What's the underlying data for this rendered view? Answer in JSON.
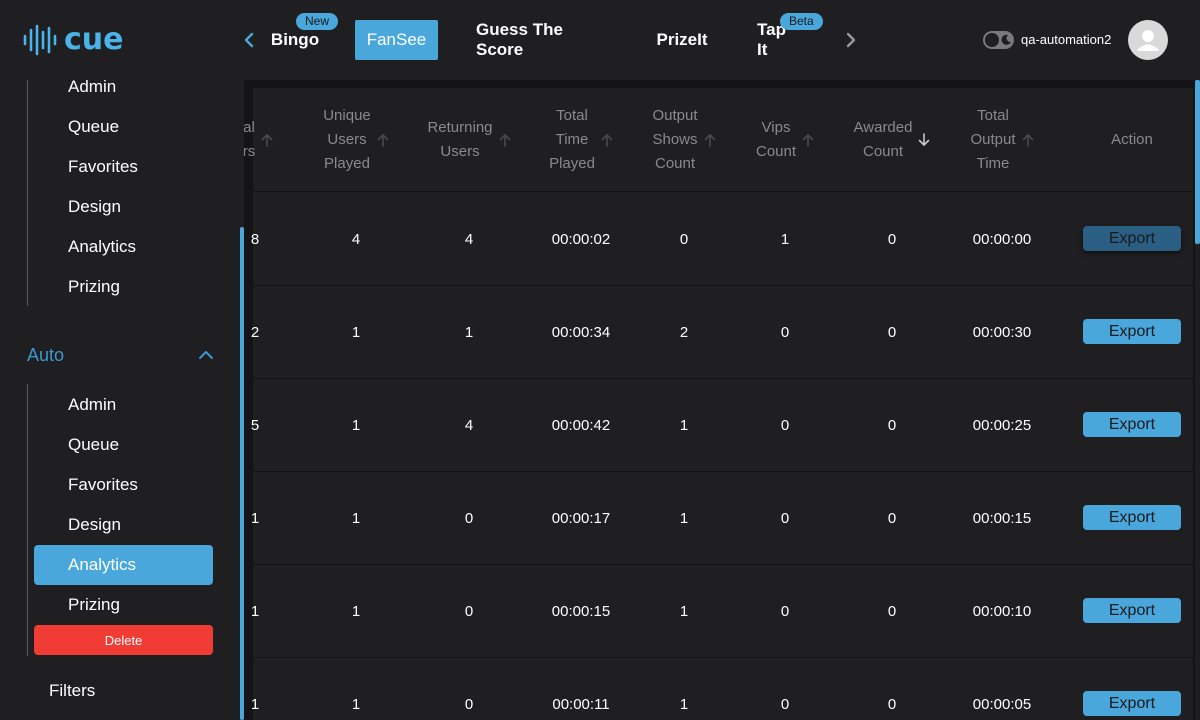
{
  "logo": {
    "text": "cue"
  },
  "nav": {
    "tabs": [
      {
        "label": "Bingo",
        "badge": "New"
      },
      {
        "label": "FanSee",
        "active": true
      },
      {
        "label": "Guess The Score"
      },
      {
        "label": "PrizeIt"
      },
      {
        "label": "Tap It",
        "badge": "Beta"
      }
    ],
    "prev_icon": "chevron-left-icon",
    "next_icon": "chevron-right-icon"
  },
  "user": {
    "name": "qa-automation2",
    "avatar_icon": "user-icon",
    "theme_icon": "moon-icon"
  },
  "sidebar": {
    "group1_items": [
      "Admin",
      "Queue",
      "Favorites",
      "Design",
      "Analytics",
      "Prizing"
    ],
    "section_title": "Auto",
    "group2_items": [
      "Admin",
      "Queue",
      "Favorites",
      "Design",
      "Analytics",
      "Prizing"
    ],
    "active_item": "Analytics",
    "delete_label": "Delete",
    "filters_label": "Filters"
  },
  "table": {
    "headers": [
      {
        "label": "al\nrs"
      },
      {
        "label": "Unique\nUsers\nPlayed"
      },
      {
        "label": "Returning\nUsers"
      },
      {
        "label": "Total\nTime\nPlayed"
      },
      {
        "label": "Output\nShows\nCount"
      },
      {
        "label": "Vips\nCount"
      },
      {
        "label": "Awarded\nCount",
        "sorted": "desc"
      },
      {
        "label": "Total\nOutput\nTime"
      },
      {
        "label": "Action"
      }
    ],
    "rows": [
      {
        "cells": [
          "8",
          "4",
          "4",
          "00:00:02",
          "0",
          "1",
          "0",
          "00:00:00"
        ],
        "action": "Export"
      },
      {
        "cells": [
          "2",
          "1",
          "1",
          "00:00:34",
          "2",
          "0",
          "0",
          "00:00:30"
        ],
        "action": "Export"
      },
      {
        "cells": [
          "5",
          "1",
          "4",
          "00:00:42",
          "1",
          "0",
          "0",
          "00:00:25"
        ],
        "action": "Export"
      },
      {
        "cells": [
          "1",
          "1",
          "0",
          "00:00:17",
          "1",
          "0",
          "0",
          "00:00:15"
        ],
        "action": "Export"
      },
      {
        "cells": [
          "1",
          "1",
          "0",
          "00:00:15",
          "1",
          "0",
          "0",
          "00:00:10"
        ],
        "action": "Export"
      },
      {
        "cells": [
          "1",
          "1",
          "0",
          "00:00:11",
          "1",
          "0",
          "0",
          "00:00:05"
        ],
        "action": "Export"
      }
    ]
  },
  "colors": {
    "accent": "#49a7dc",
    "danger": "#f03c34",
    "background": "#1f1f21"
  }
}
